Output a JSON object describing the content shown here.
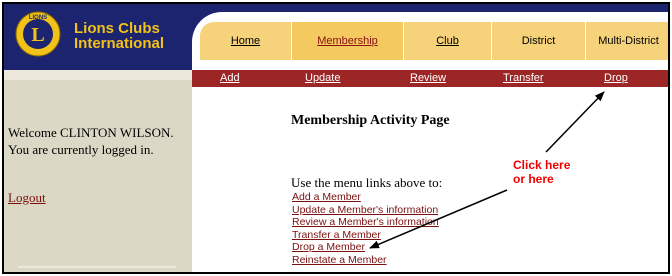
{
  "brand": {
    "line1": "Lions Clubs",
    "line2": "International",
    "logo_text": "LIONS"
  },
  "nav": {
    "tabs": [
      {
        "label": "Home"
      },
      {
        "label": "Membership"
      },
      {
        "label": "Club"
      },
      {
        "label": "District"
      },
      {
        "label": "Multi-District"
      }
    ],
    "active_tab": "Membership"
  },
  "submenu": {
    "items": [
      "Add",
      "Update",
      "Review",
      "Transfer",
      "Drop"
    ]
  },
  "sidebar": {
    "welcome": "Welcome CLINTON WILSON. You are currently logged in.",
    "logout": "Logout"
  },
  "main": {
    "title": "Membership Activity Page",
    "intro": "Use the menu links above to:",
    "links": [
      "Add a Member",
      "Update a Member's information",
      "Review a Member's information",
      "Transfer a Member",
      "Drop a Member",
      "Reinstate a Member"
    ]
  },
  "annotation": {
    "line1": "Click here",
    "line2": "or here"
  },
  "colors": {
    "navy": "#1c2470",
    "gold": "#f0c21a",
    "tab": "#f6d27a",
    "submenu": "#9c2525",
    "link": "#7a1010",
    "callout": "#ee0000",
    "sidebar": "#dcd8c6"
  }
}
